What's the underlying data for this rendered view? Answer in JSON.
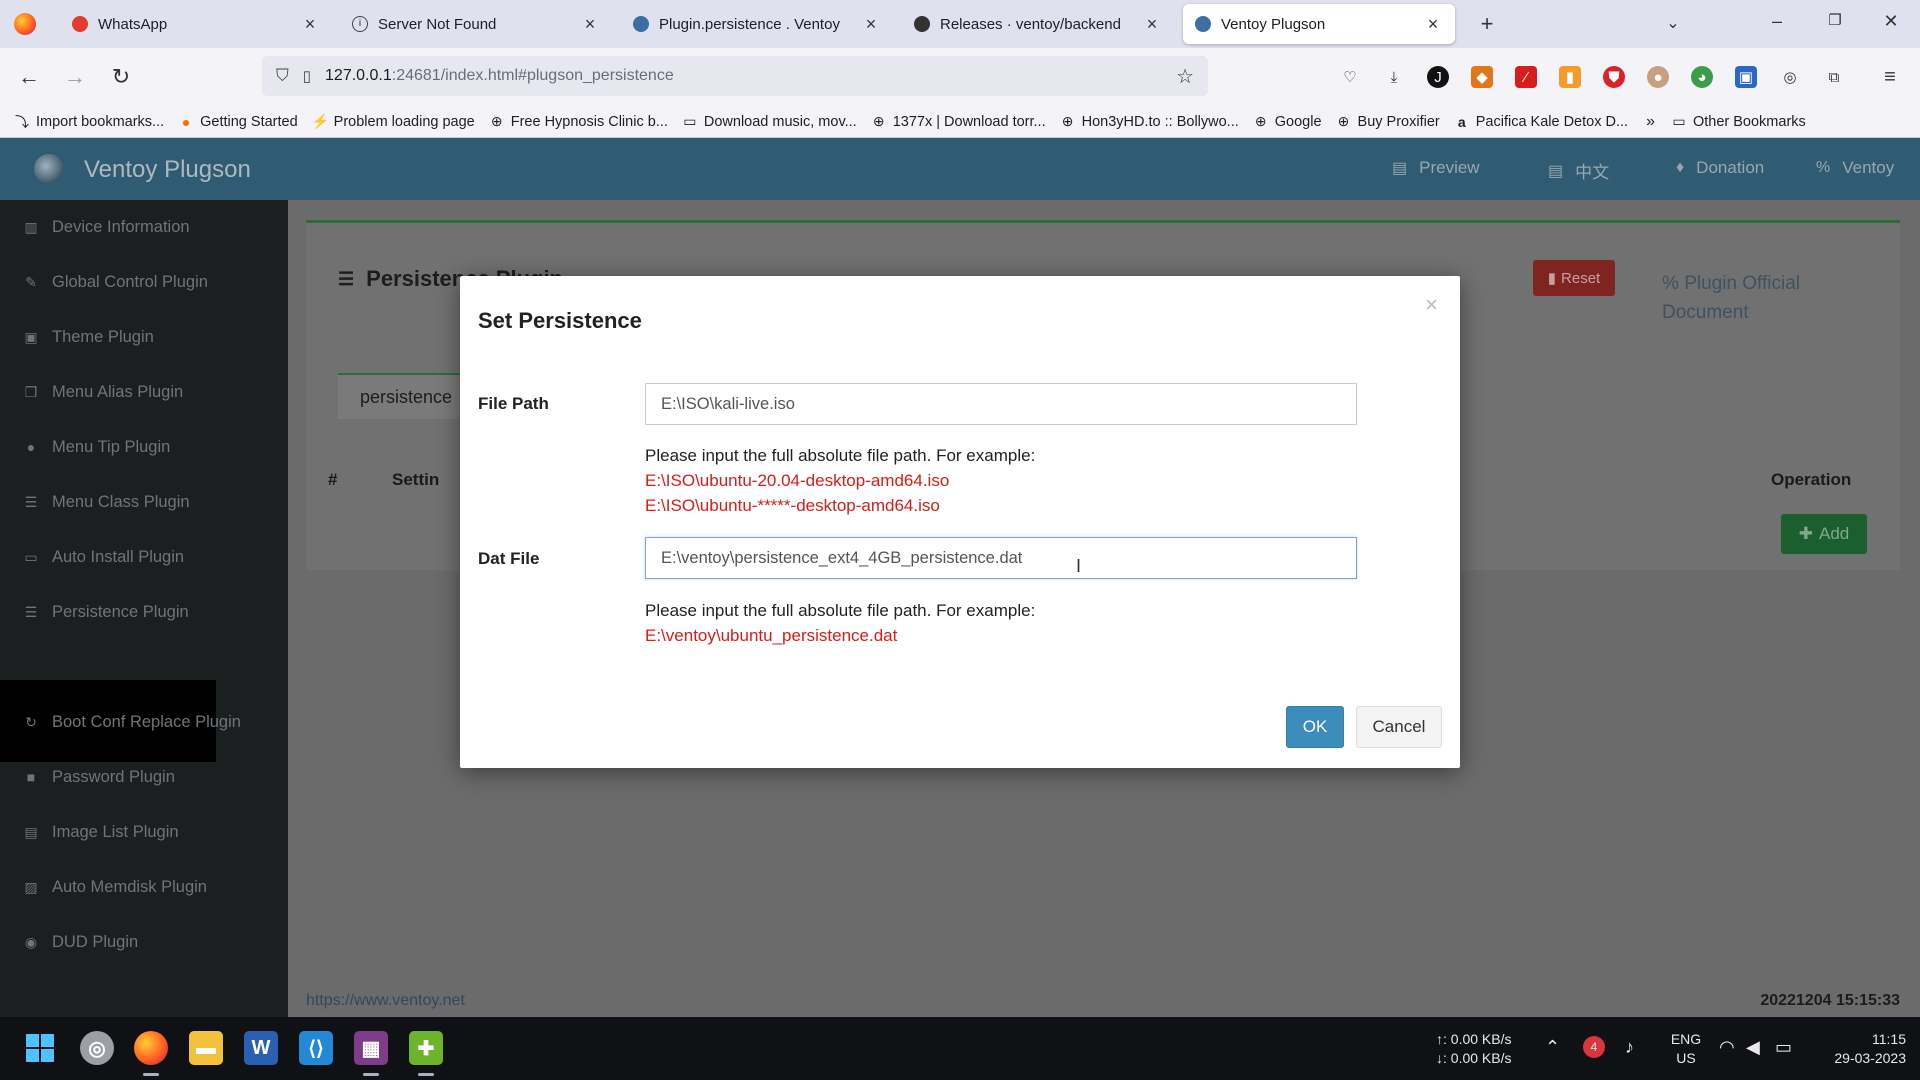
{
  "browser": {
    "tabs": [
      {
        "title": "WhatsApp",
        "icon": "whatsapp-icon",
        "color": "#e63a2e"
      },
      {
        "title": "Server Not Found",
        "icon": "info-icon",
        "color": "#444444"
      },
      {
        "title": "Plugin.persistence . Ventoy",
        "icon": "ventoy-icon",
        "color": "#3a6ea5"
      },
      {
        "title": "Releases · ventoy/backend",
        "icon": "github-icon",
        "color": "#333333"
      },
      {
        "title": "Ventoy Plugson",
        "icon": "ventoy-icon",
        "color": "#3a6ea5"
      }
    ],
    "active_tab": 4,
    "url_host": "127.0.0.1",
    "url_rest": ":24681/index.html#plugson_persistence",
    "bookmarks": [
      {
        "label": "Import bookmarks...",
        "icon": "import-icon"
      },
      {
        "label": "Getting Started",
        "icon": "firefox-icon"
      },
      {
        "label": "Problem loading page",
        "icon": "lightning-icon"
      },
      {
        "label": "Free Hypnosis Clinic b...",
        "icon": "globe-icon"
      },
      {
        "label": "Download music, mov...",
        "icon": "monitor-icon"
      },
      {
        "label": "1377x | Download torr...",
        "icon": "globe-icon"
      },
      {
        "label": "Hon3yHD.to :: Bollywo...",
        "icon": "globe-icon"
      },
      {
        "label": "Google",
        "icon": "globe-icon"
      },
      {
        "label": "Buy Proxifier",
        "icon": "globe-icon"
      },
      {
        "label": "Pacifica Kale Detox D...",
        "icon": "amazon-icon"
      }
    ],
    "other_bookmarks": "Other Bookmarks"
  },
  "app": {
    "brand": "Ventoy Plugson",
    "header_links": [
      {
        "label": "Preview",
        "icon": "file-icon"
      },
      {
        "label": "中文",
        "icon": "language-icon"
      },
      {
        "label": "Donation",
        "icon": "donate-icon"
      },
      {
        "label": "Ventoy",
        "icon": "link-icon"
      }
    ],
    "sidebar": [
      {
        "label": "Device Information",
        "icon": "bank-icon"
      },
      {
        "label": "Global Control Plugin",
        "icon": "wrench-icon"
      },
      {
        "label": "Theme Plugin",
        "icon": "image-icon"
      },
      {
        "label": "Menu Alias Plugin",
        "icon": "copy-icon"
      },
      {
        "label": "Menu Tip Plugin",
        "icon": "comment-icon"
      },
      {
        "label": "Menu Class Plugin",
        "icon": "list-icon"
      },
      {
        "label": "Auto Install Plugin",
        "icon": "desktop-icon"
      },
      {
        "label": "Persistence Plugin",
        "icon": "database-icon"
      },
      {
        "label": "Boot Conf Replace Plugin",
        "icon": "refresh-icon"
      },
      {
        "label": "Password Plugin",
        "icon": "lock-icon"
      },
      {
        "label": "Image List Plugin",
        "icon": "list-alt-icon"
      },
      {
        "label": "Auto Memdisk Plugin",
        "icon": "save-icon"
      },
      {
        "label": "DUD Plugin",
        "icon": "disc-icon"
      }
    ],
    "panel": {
      "title": "Persistence Plugin",
      "reset_label": "Reset",
      "official_doc": "Plugin Official Document",
      "tab_label": "persistence",
      "col_index": "#",
      "col_setting": "Settin",
      "col_operation": "Operation",
      "add_label": "Add"
    },
    "footer": {
      "link": "https://www.ventoy.net",
      "version": "20221204 15:15:33"
    }
  },
  "modal": {
    "title": "Set Persistence",
    "file_path_label": "File Path",
    "file_path_value": "E:\\ISO\\kali-live.iso",
    "file_hint": "Please input the full absolute file path. For example:",
    "file_example_1": "E:\\ISO\\ubuntu-20.04-desktop-amd64.iso",
    "file_example_2": "E:\\ISO\\ubuntu-*****-desktop-amd64.iso",
    "dat_file_label": "Dat File",
    "dat_file_value": "E:\\ventoy\\persistence_ext4_4GB_persistence.dat",
    "dat_hint": "Please input the full absolute file path. For example:",
    "dat_example": "E:\\ventoy\\ubuntu_persistence.dat",
    "ok_label": "OK",
    "cancel_label": "Cancel"
  },
  "taskbar": {
    "apps": [
      {
        "name": "start-icon"
      },
      {
        "name": "disk-icon"
      },
      {
        "name": "firefox-icon"
      },
      {
        "name": "file-explorer-icon"
      },
      {
        "name": "word-icon"
      },
      {
        "name": "vscode-icon"
      },
      {
        "name": "winrar-icon"
      },
      {
        "name": "puzzle-icon"
      }
    ],
    "net_up": "↑: 0.00 KB/s",
    "net_down": "↓: 0.00 KB/s",
    "lang_1": "ENG",
    "lang_2": "US",
    "time": "11:15",
    "date": "29-03-2023",
    "badge_count": "4"
  }
}
